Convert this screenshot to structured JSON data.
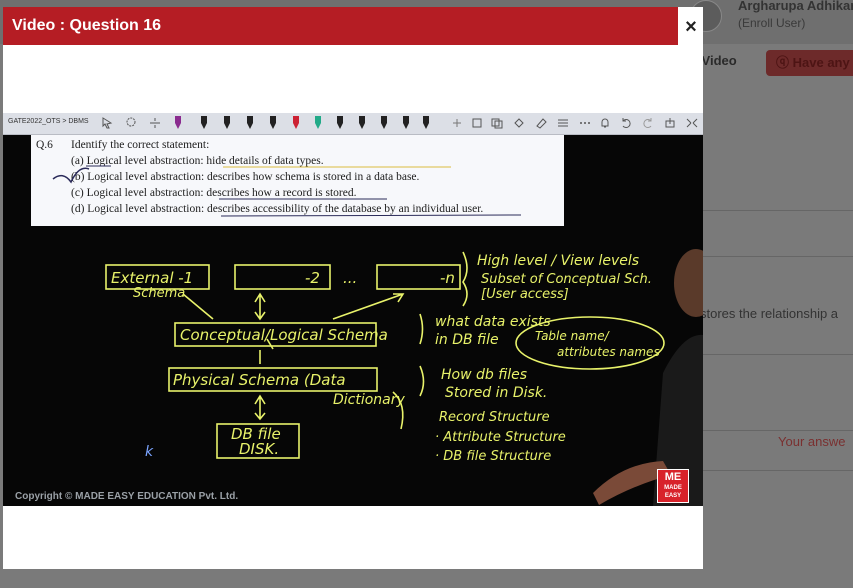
{
  "background": {
    "user_name": "Argharupa Adhikari",
    "user_role": "(Enroll User)",
    "video_button": "n Video",
    "doubt_button": "Have any",
    "body_text": "stores the relationship a",
    "answer_text": "Your answe"
  },
  "modal": {
    "title": "Video : Question 16",
    "close_icon": "×"
  },
  "video": {
    "toolbar_breadcrumb": "GATE2022_OTS > DBMS",
    "question": {
      "number": "Q.6",
      "stem": "Identify the correct statement:",
      "options": [
        {
          "label": "(a)",
          "text": "Logical level abstraction: hide details of data types."
        },
        {
          "label": "(b)",
          "text": "Logical level abstraction: describes how schema is stored in a data base."
        },
        {
          "label": "(c)",
          "text": "Logical level abstraction: describes how a record is stored."
        },
        {
          "label": "(d)",
          "text": "Logical level abstraction: describes accessibility of the database by an individual user."
        }
      ]
    },
    "board": {
      "external_schema_1": "External -1",
      "external_schema_label": "Schema",
      "external_schema_2": "-2",
      "ellipsis": "...",
      "external_schema_n": "-n",
      "conceptual": "Conceptual/Logical Schema",
      "physical": "Physical Schema (Data",
      "dictionary": "Dictionary",
      "dbfile": "DB file",
      "disk": "DISK.",
      "note1_line1": "High level / View levels",
      "note1_line2": "Subset of Conceptual Sch.",
      "note1_line3": "[User access]",
      "note2_line1": "what data exists",
      "note2_line2": "in DB file",
      "note2_bubble1": "Table name/",
      "note2_bubble2": "attributes names",
      "note3_line1": "How db files",
      "note3_line2": "Stored in Disk.",
      "note3_item1": "Record Structure",
      "note3_item2": "· Attribute Structure",
      "note3_item3": "· DB file Structure",
      "cursor_mark": "k"
    },
    "copyright": "Copyright © MADE EASY EDUCATION Pvt. Ltd.",
    "logo_mark": "ME",
    "logo_text_1": "MADE",
    "logo_text_2": "EASY",
    "colors": {
      "chalk": "#e8f26a",
      "header": "#b51d24",
      "logo": "#d8222a"
    }
  }
}
